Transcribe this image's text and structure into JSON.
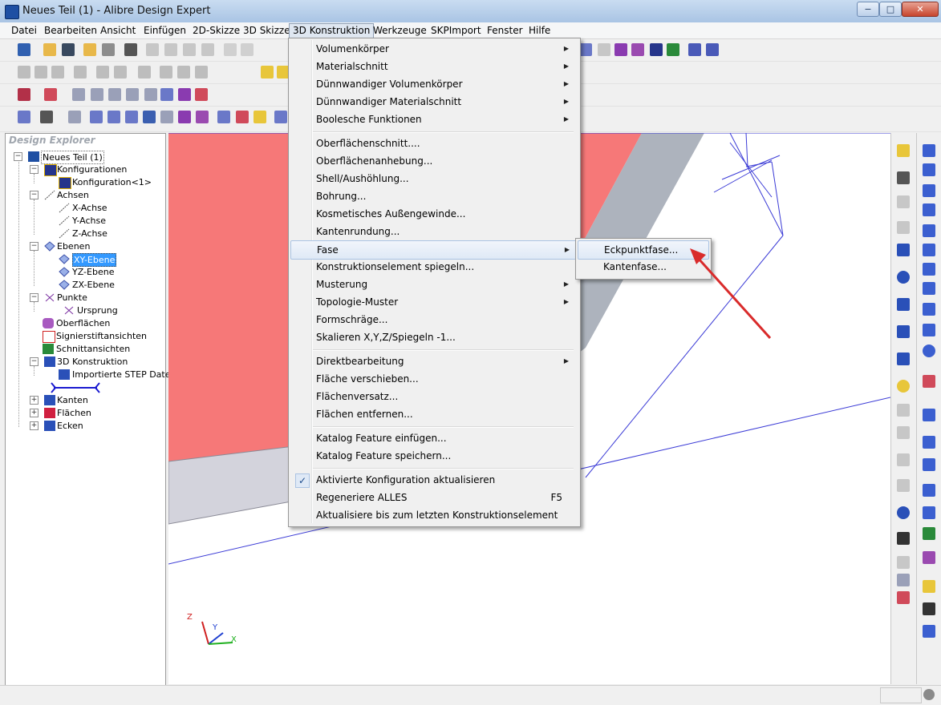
{
  "window": {
    "title": "Neues Teil (1) - Alibre Design Expert",
    "minimize": "−",
    "maximize": "□",
    "close": "✕"
  },
  "menubar": {
    "items": [
      "Datei",
      "Bearbeiten",
      "Ansicht",
      "Einfügen",
      "2D-Skizze",
      "3D Skizze",
      "3D Konstruktion",
      "Werkzeuge",
      "SKPImport",
      "Fenster",
      "Hilfe"
    ]
  },
  "explorer": {
    "title": "Design Explorer",
    "root": "Neues Teil (1)",
    "konfigurationen": "Konfigurationen",
    "konfiguration1": "Konfiguration<1>",
    "achsen": "Achsen",
    "x_achse": "X-Achse",
    "y_achse": "Y-Achse",
    "z_achse": "Z-Achse",
    "ebenen": "Ebenen",
    "xy_ebene": "XY-Ebene",
    "yz_ebene": "YZ-Ebene",
    "zx_ebene": "ZX-Ebene",
    "punkte": "Punkte",
    "ursprung": "Ursprung",
    "oberflaechen": "Oberflächen",
    "signierstift": "Signierstiftansichten",
    "schnitt": "Schnittansichten",
    "konstruktion": "3D Konstruktion",
    "step": "Importierte STEP Datei",
    "kanten": "Kanten",
    "flaechen": "Flächen",
    "ecken": "Ecken"
  },
  "menu": {
    "volumenkoerper": "Volumenkörper",
    "materialschnitt": "Materialschnitt",
    "duennwandig_vk": "Dünnwandiger Volumenkörper",
    "duennwandig_ms": "Dünnwandiger Materialschnitt",
    "boolesche": "Boolesche Funktionen",
    "oberflaechenschnitt": "Oberflächenschnitt....",
    "oberflaechenanhebung": "Oberflächenanhebung...",
    "shell": "Shell/Aushöhlung...",
    "bohrung": "Bohrung...",
    "gewinde": "Kosmetisches Außengewinde...",
    "kantenrundung": "Kantenrundung...",
    "fase": "Fase",
    "spiegeln": "Konstruktionselement spiegeln...",
    "musterung": "Musterung",
    "topologie": "Topologie-Muster",
    "formschraege": "Formschräge...",
    "skalieren": "Skalieren X,Y,Z/Spiegeln -1...",
    "direktbearbeitung": "Direktbearbeitung",
    "flaeche_verschieben": "Fläche verschieben...",
    "flaechenversatz": "Flächenversatz...",
    "flaechen_entfernen": "Flächen entfernen...",
    "katalog_einfuegen": "Katalog Feature einfügen...",
    "katalog_speichern": "Katalog Feature speichern...",
    "aktivierte_konfig": "Aktivierte Konfiguration aktualisieren",
    "regeneriere": "Regeneriere ALLES",
    "regeneriere_shortcut": "F5",
    "aktualisiere": "Aktualisiere bis zum letzten Konstruktionselement"
  },
  "submenu": {
    "eckpunktfase": "Eckpunktfase...",
    "kantenfase": "Kantenfase..."
  },
  "triad": {
    "x": "X",
    "y": "Y",
    "z": "Z"
  },
  "colors": {
    "face_red": "#f67878",
    "face_gray": "#adb3bd",
    "face_light": "#d3d3dc",
    "construction_line": "#3b3bd6",
    "arrow": "#d92b2b",
    "selection": "#3399ff"
  }
}
